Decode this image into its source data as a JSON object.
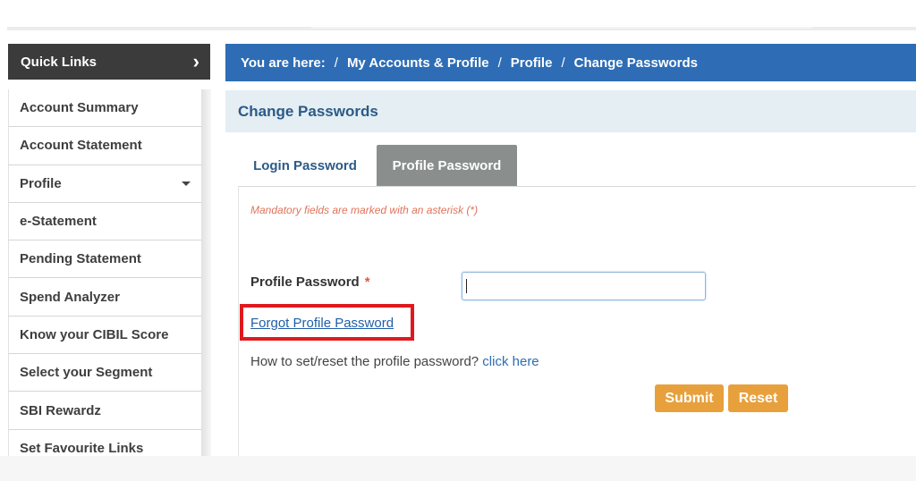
{
  "sidebar": {
    "title": "Quick Links",
    "items": [
      {
        "label": "Account Summary"
      },
      {
        "label": "Account Statement"
      },
      {
        "label": "Profile"
      },
      {
        "label": "e-Statement"
      },
      {
        "label": "Pending Statement"
      },
      {
        "label": "Spend Analyzer"
      },
      {
        "label": "Know your CIBIL Score"
      },
      {
        "label": "Select your Segment"
      },
      {
        "label": "SBI Rewardz"
      },
      {
        "label": "Set Favourite Links"
      }
    ]
  },
  "breadcrumb": {
    "prefix": "You are here:",
    "items": [
      "My Accounts & Profile",
      "Profile",
      "Change Passwords"
    ],
    "separator": "/"
  },
  "panel": {
    "title": "Change Passwords",
    "tabs": [
      {
        "label": "Login Password",
        "active": false
      },
      {
        "label": "Profile Password",
        "active": true
      }
    ]
  },
  "form": {
    "mandatory_note": "Mandatory fields are marked with an asterisk (*)",
    "profile_password_label": "Profile Password",
    "asterisk": "*",
    "profile_password_value": "",
    "forgot_link": "Forgot Profile Password",
    "howto_text": "How to set/reset the profile password?",
    "howto_link": "click here",
    "submit_label": "Submit",
    "reset_label": "Reset"
  },
  "colors": {
    "breadcrumb_bg": "#2e6db5",
    "quicklinks_bg": "#3b3b3b",
    "active_tab_bg": "#8a8f8e",
    "button_bg": "#e8a03c",
    "highlight_border": "#e0191e"
  }
}
